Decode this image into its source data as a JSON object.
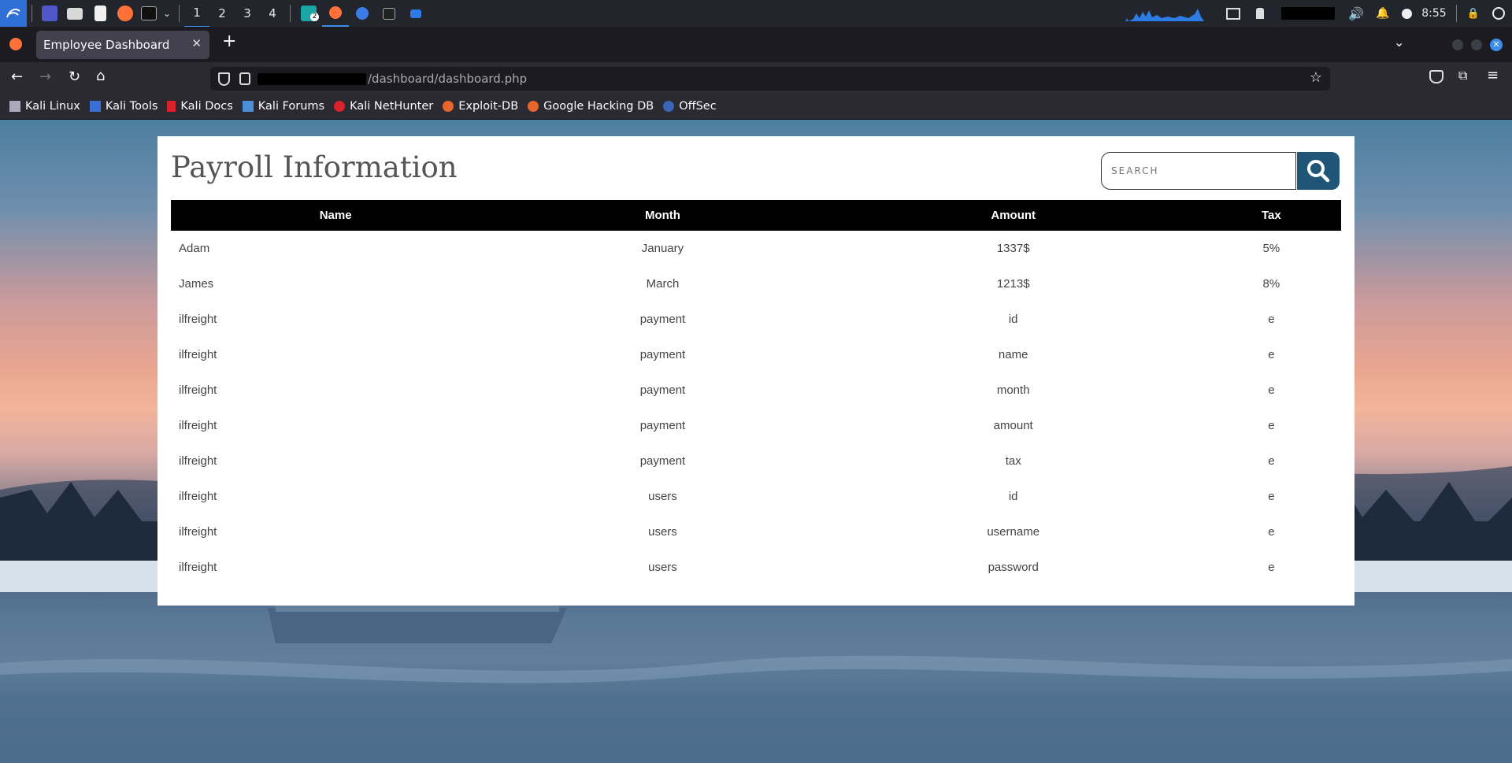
{
  "taskbar": {
    "workspaces": [
      "1",
      "2",
      "3",
      "4"
    ],
    "active_workspace": "1",
    "notification_badge": "2",
    "clock": "8:55"
  },
  "browser": {
    "tab_title": "Employee Dashboard",
    "url_path": "/dashboard/dashboard.php",
    "bookmarks": [
      "Kali Linux",
      "Kali Tools",
      "Kali Docs",
      "Kali Forums",
      "Kali NetHunter",
      "Exploit-DB",
      "Google Hacking DB",
      "OffSec"
    ]
  },
  "page": {
    "title": "Payroll Information",
    "search_placeholder": "SEARCH",
    "columns": [
      "Name",
      "Month",
      "Amount",
      "Tax"
    ],
    "rows": [
      [
        "Adam",
        "January",
        "1337$",
        "5%"
      ],
      [
        "James",
        "March",
        "1213$",
        "8%"
      ],
      [
        "ilfreight",
        "payment",
        "id",
        "e"
      ],
      [
        "ilfreight",
        "payment",
        "name",
        "e"
      ],
      [
        "ilfreight",
        "payment",
        "month",
        "e"
      ],
      [
        "ilfreight",
        "payment",
        "amount",
        "e"
      ],
      [
        "ilfreight",
        "payment",
        "tax",
        "e"
      ],
      [
        "ilfreight",
        "users",
        "id",
        "e"
      ],
      [
        "ilfreight",
        "users",
        "username",
        "e"
      ],
      [
        "ilfreight",
        "users",
        "password",
        "e"
      ]
    ]
  },
  "colors": {
    "search_button": "#1f5677",
    "table_header": "#000000",
    "accent": "#3b8eea"
  }
}
